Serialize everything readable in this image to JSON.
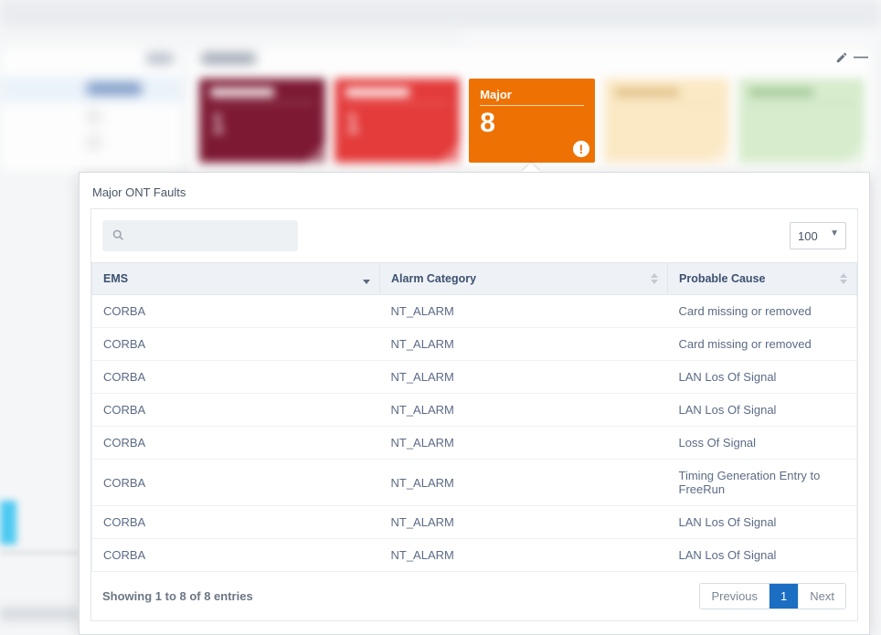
{
  "panel": {
    "title": "Major ONT Faults"
  },
  "summary_cards": {
    "card1_count": "1",
    "card2_count": "1",
    "orange_label": "Major",
    "orange_count": "8"
  },
  "toolbar": {
    "search_placeholder": "",
    "page_size_options": [
      "100"
    ],
    "page_size_selected": "100"
  },
  "table": {
    "columns": {
      "ems": "EMS",
      "alarm": "Alarm Category",
      "cause": "Probable Cause"
    },
    "rows": [
      {
        "ems": "CORBA",
        "alarm": "NT_ALARM",
        "cause": "Card missing or removed"
      },
      {
        "ems": "CORBA",
        "alarm": "NT_ALARM",
        "cause": "Card missing or removed"
      },
      {
        "ems": "CORBA",
        "alarm": "NT_ALARM",
        "cause": "LAN Los Of Signal"
      },
      {
        "ems": "CORBA",
        "alarm": "NT_ALARM",
        "cause": "LAN Los Of Signal"
      },
      {
        "ems": "CORBA",
        "alarm": "NT_ALARM",
        "cause": "Loss Of Signal"
      },
      {
        "ems": "CORBA",
        "alarm": "NT_ALARM",
        "cause": "Timing Generation Entry to FreeRun"
      },
      {
        "ems": "CORBA",
        "alarm": "NT_ALARM",
        "cause": "LAN Los Of Signal"
      },
      {
        "ems": "CORBA",
        "alarm": "NT_ALARM",
        "cause": "LAN Los Of Signal"
      }
    ]
  },
  "footer": {
    "info": "Showing 1 to 8 of 8 entries",
    "prev": "Previous",
    "page": "1",
    "next": "Next"
  }
}
